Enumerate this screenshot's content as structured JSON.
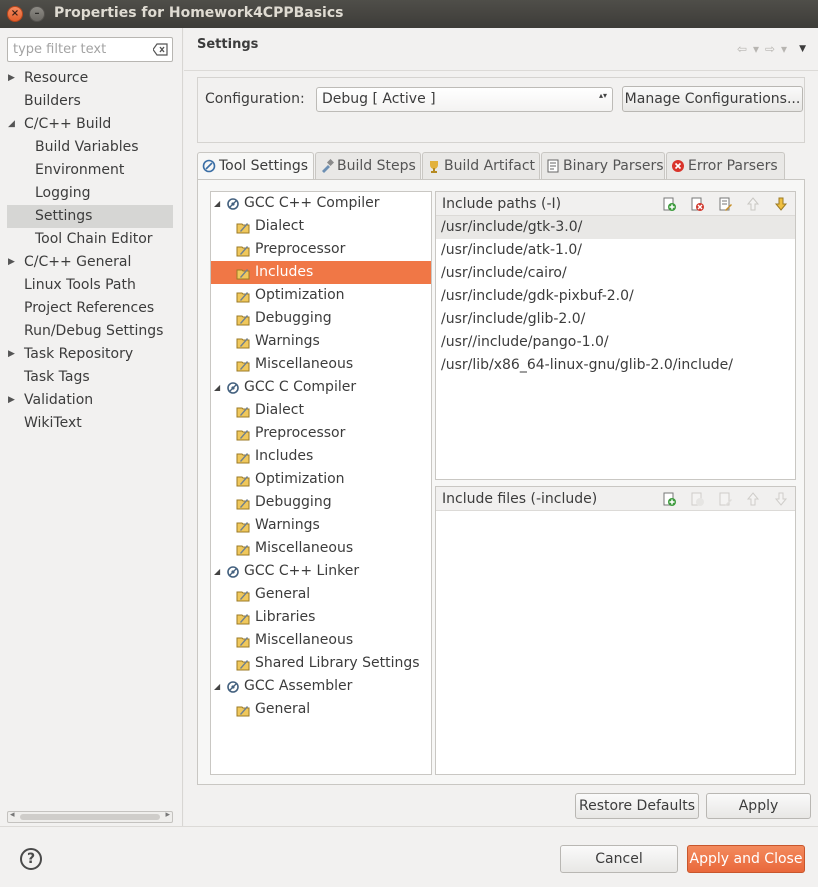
{
  "window": {
    "title": "Properties for Homework4CPPBasics",
    "close_glyph": "×",
    "minimize_glyph": "–"
  },
  "filter": {
    "placeholder": "type filter text"
  },
  "nav": {
    "items": [
      {
        "label": "Resource",
        "arrow": "▶"
      },
      {
        "label": "Builders",
        "arrow": ""
      },
      {
        "label": "C/C++ Build",
        "arrow": "◢"
      },
      {
        "label": "Build Variables",
        "arrow": ""
      },
      {
        "label": "Environment",
        "arrow": ""
      },
      {
        "label": "Logging",
        "arrow": ""
      },
      {
        "label": "Settings",
        "arrow": ""
      },
      {
        "label": "Tool Chain Editor",
        "arrow": ""
      },
      {
        "label": "C/C++ General",
        "arrow": "▶"
      },
      {
        "label": "Linux Tools Path",
        "arrow": ""
      },
      {
        "label": "Project References",
        "arrow": ""
      },
      {
        "label": "Run/Debug Settings",
        "arrow": ""
      },
      {
        "label": "Task Repository",
        "arrow": "▶"
      },
      {
        "label": "Task Tags",
        "arrow": ""
      },
      {
        "label": "Validation",
        "arrow": "▶"
      },
      {
        "label": "WikiText",
        "arrow": ""
      }
    ]
  },
  "page": {
    "title": "Settings",
    "nav_icons": {
      "back": "⇦",
      "dropdown": "▾",
      "forward": "⇨",
      "menu": "▼"
    }
  },
  "config": {
    "label": "Configuration:",
    "value": "Debug  [ Active ]",
    "spin": "▴▾",
    "manage_label": "Manage Configurations..."
  },
  "tabs": [
    {
      "label": "Tool Settings"
    },
    {
      "label": "Build Steps"
    },
    {
      "label": "Build Artifact"
    },
    {
      "label": "Binary Parsers"
    },
    {
      "label": "Error Parsers"
    }
  ],
  "tree": {
    "expanded_arrow": "◢",
    "nodes": [
      {
        "label": "GCC C++ Compiler"
      },
      {
        "label": "Dialect"
      },
      {
        "label": "Preprocessor"
      },
      {
        "label": "Includes"
      },
      {
        "label": "Optimization"
      },
      {
        "label": "Debugging"
      },
      {
        "label": "Warnings"
      },
      {
        "label": "Miscellaneous"
      },
      {
        "label": "GCC C Compiler"
      },
      {
        "label": "Dialect"
      },
      {
        "label": "Preprocessor"
      },
      {
        "label": "Includes"
      },
      {
        "label": "Optimization"
      },
      {
        "label": "Debugging"
      },
      {
        "label": "Warnings"
      },
      {
        "label": "Miscellaneous"
      },
      {
        "label": "GCC C++ Linker"
      },
      {
        "label": "General"
      },
      {
        "label": "Libraries"
      },
      {
        "label": "Miscellaneous"
      },
      {
        "label": "Shared Library Settings"
      },
      {
        "label": "GCC Assembler"
      },
      {
        "label": "General"
      }
    ]
  },
  "include_paths": {
    "header": "Include paths (-I)",
    "items": [
      "/usr/include/gtk-3.0/",
      "/usr/include/atk-1.0/",
      "/usr/include/cairo/",
      "/usr/include/gdk-pixbuf-2.0/",
      "/usr/include/glib-2.0/",
      "/usr//include/pango-1.0/",
      "/usr/lib/x86_64-linux-gnu/glib-2.0/include/"
    ]
  },
  "include_files": {
    "header": "Include files (-include)",
    "items": []
  },
  "buttons": {
    "restore": "Restore Defaults",
    "apply": "Apply",
    "cancel": "Cancel",
    "apply_close": "Apply and Close"
  },
  "help": {
    "glyph": "?"
  },
  "scroll": {
    "left": "◂",
    "right": "▸"
  },
  "colors": {
    "selection": "#f07746",
    "title_bar": "#3d3c38",
    "close_button": "#e9683b"
  }
}
